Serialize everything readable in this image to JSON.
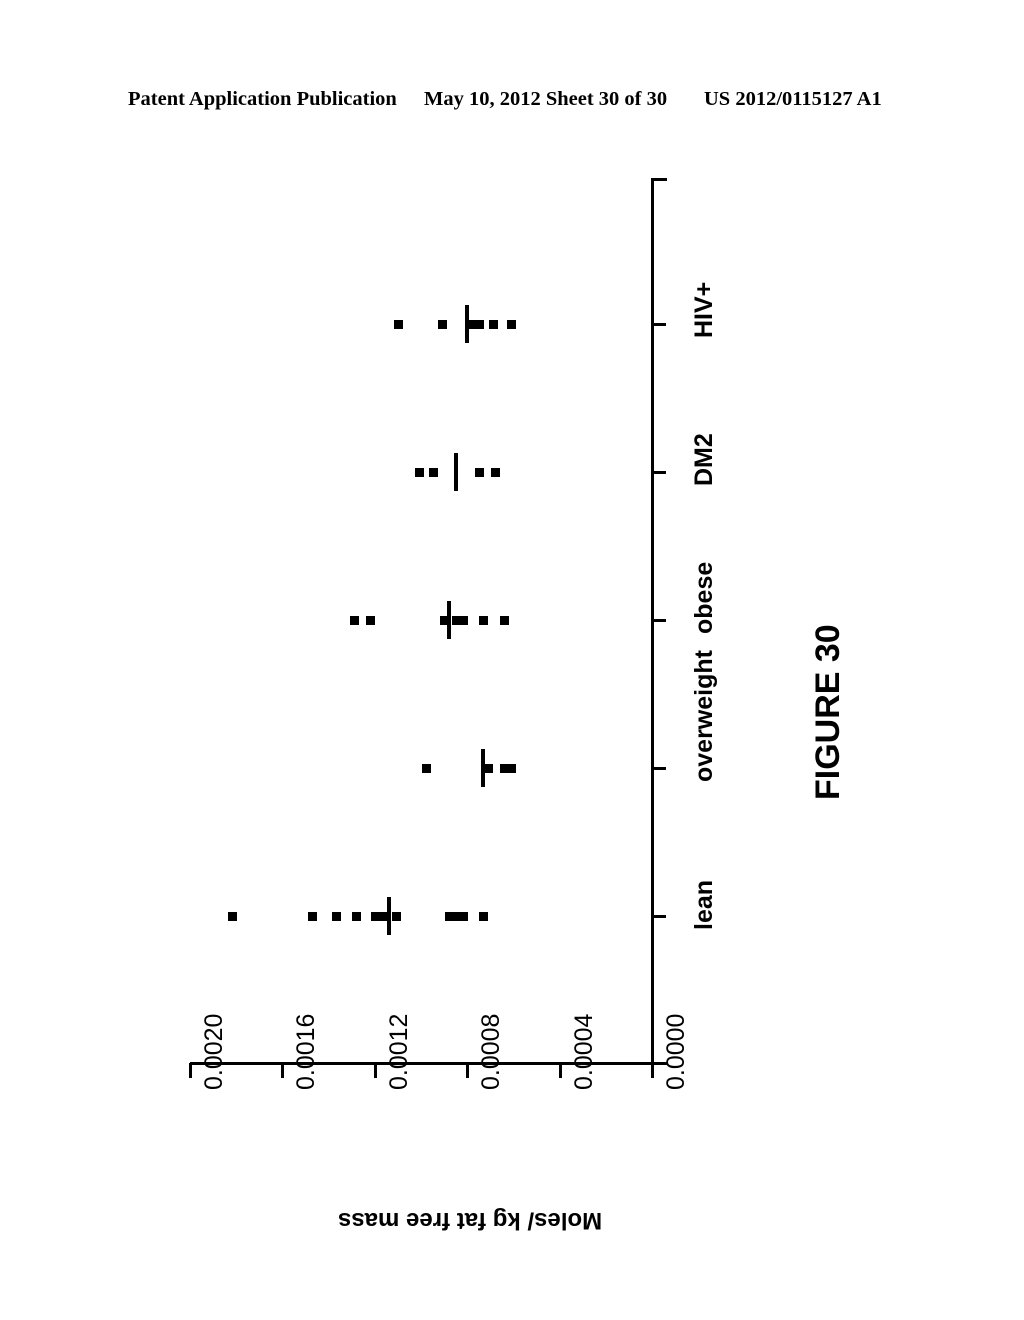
{
  "header": {
    "publication": "Patent Application Publication",
    "date_sheet": "May 10, 2012  Sheet 30 of 30",
    "doc_number": "US 2012/0115127 A1"
  },
  "figure": {
    "caption": "FIGURE 30",
    "axis_title": "Moles/ kg fat free mass"
  },
  "chart_data": {
    "type": "scatter",
    "orientation": "horizontal-strip-plot",
    "title": "FIGURE 30",
    "xlabel": "",
    "ylabel": "Moles/ kg fat free mass",
    "value_axis": {
      "ticks": [
        "0.0020",
        "0.0016",
        "0.0012",
        "0.0008",
        "0.0004",
        "0.0000"
      ],
      "tick_values": [
        0.002,
        0.0016,
        0.0012,
        0.0008,
        0.0004,
        0.0
      ],
      "range": [
        0.0,
        0.002
      ],
      "direction": "decreasing-left-to-right",
      "grid": false
    },
    "categories": [
      "lean",
      "overweight",
      "obese",
      "DM2",
      "HIV+"
    ],
    "legend": "none",
    "series": [
      {
        "name": "lean",
        "median": 0.00114,
        "values": [
          0.00182,
          0.00147,
          0.00137,
          0.00128,
          0.0012,
          0.00117,
          0.00111,
          0.00088,
          0.00085,
          0.00082,
          0.00073
        ]
      },
      {
        "name": "overweight",
        "median": 0.00073,
        "values": [
          0.00098,
          0.00071,
          0.00064,
          0.00061
        ]
      },
      {
        "name": "obese",
        "median": 0.00088,
        "values": [
          0.00129,
          0.00122,
          0.0009,
          0.00085,
          0.00082,
          0.00073,
          0.00064
        ]
      },
      {
        "name": "DM2",
        "median": 0.00085,
        "values": [
          0.00101,
          0.00095,
          0.00075,
          0.00068
        ]
      },
      {
        "name": "HIV+",
        "median": 0.0008,
        "values": [
          0.0011,
          0.00091,
          0.00078,
          0.00075,
          0.00069,
          0.00061
        ]
      }
    ]
  }
}
